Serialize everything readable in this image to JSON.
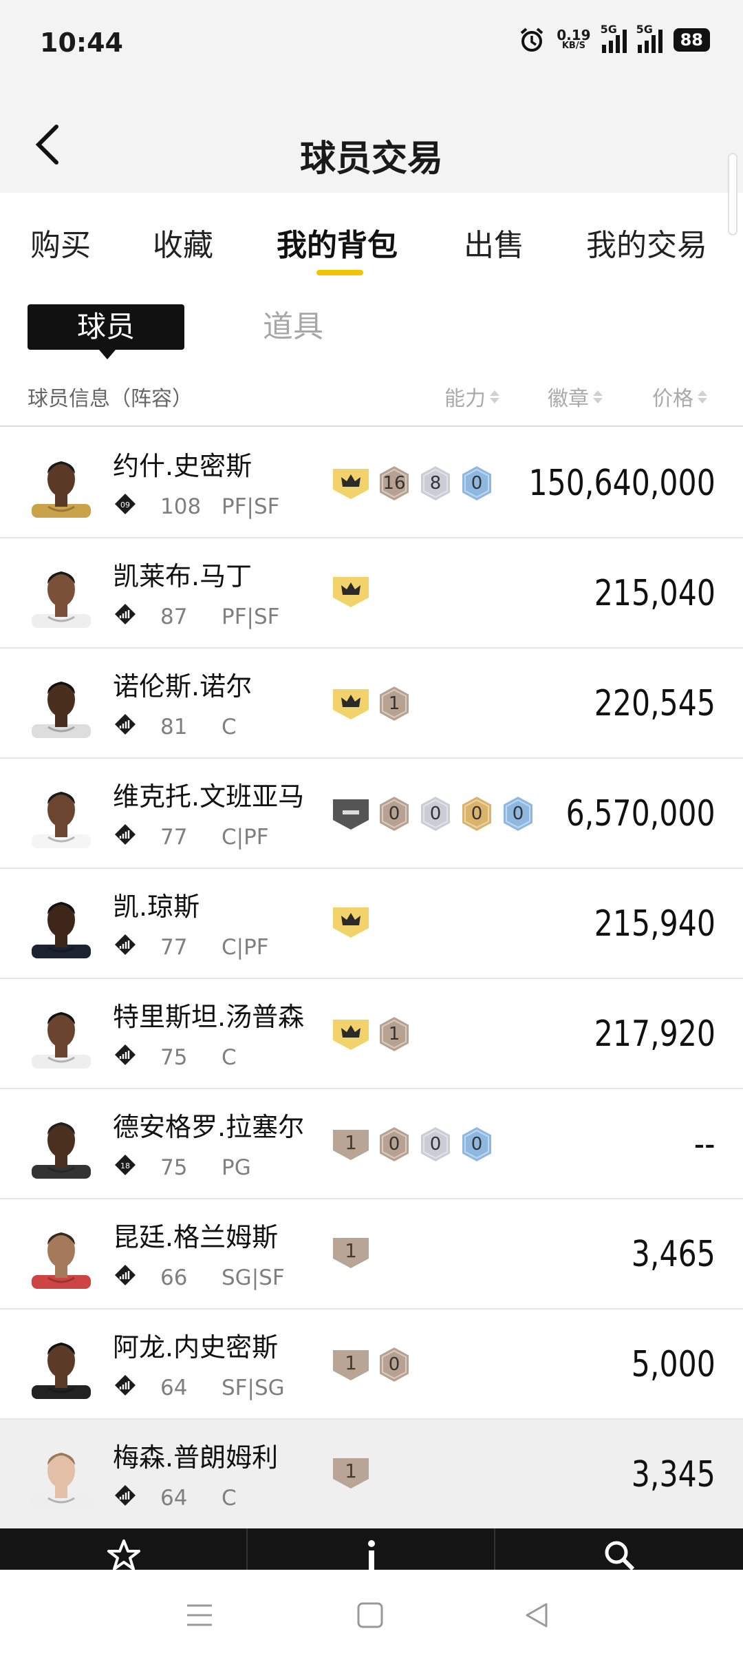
{
  "status_bar": {
    "time": "10:44",
    "net_speed_value": "0.19",
    "net_speed_unit": "KB/S",
    "signal1_label": "5G",
    "signal2_label": "5G",
    "battery": "88"
  },
  "header": {
    "title": "球员交易"
  },
  "tabs": [
    {
      "label": "购买"
    },
    {
      "label": "收藏"
    },
    {
      "label": "我的背包"
    },
    {
      "label": "出售"
    },
    {
      "label": "我的交易"
    }
  ],
  "subtabs": {
    "active": "球员",
    "inactive": "道具"
  },
  "columns": {
    "info": "球员信息（阵容）",
    "ability": "能力",
    "badge": "徽章",
    "price": "价格"
  },
  "colors": {
    "accent": "#f2c300",
    "gold_shield": "#f2d36b",
    "bronze": "#b7a292",
    "silver": "#c8cdd6",
    "gold": "#d9b46a",
    "blue": "#8fb8e0"
  },
  "players": [
    {
      "name": "约什.史密斯",
      "tier": "09",
      "ovr": "108",
      "pos": "PF|SF",
      "price": "150,640,000",
      "badges": [
        {
          "kind": "crown",
          "color": "gold_shield"
        },
        {
          "kind": "hex",
          "text": "16",
          "color": "bronze"
        },
        {
          "kind": "hex",
          "text": "8",
          "color": "silver"
        },
        {
          "kind": "hex",
          "text": "0",
          "color": "blue"
        }
      ]
    },
    {
      "name": "凯莱布.马丁",
      "tier": "",
      "ovr": "87",
      "pos": "PF|SF",
      "price": "215,040",
      "badges": [
        {
          "kind": "crown",
          "color": "gold_shield"
        }
      ]
    },
    {
      "name": "诺伦斯.诺尔",
      "tier": "",
      "ovr": "81",
      "pos": "C",
      "price": "220,545",
      "badges": [
        {
          "kind": "crown",
          "color": "gold_shield"
        },
        {
          "kind": "hex",
          "text": "1",
          "color": "bronze"
        }
      ]
    },
    {
      "name": "维克托.文班亚马",
      "tier": "",
      "ovr": "77",
      "pos": "C|PF",
      "price": "6,570,000",
      "badges": [
        {
          "kind": "dash"
        },
        {
          "kind": "hex",
          "text": "0",
          "color": "bronze"
        },
        {
          "kind": "hex",
          "text": "0",
          "color": "silver"
        },
        {
          "kind": "hex",
          "text": "0",
          "color": "gold"
        },
        {
          "kind": "hex",
          "text": "0",
          "color": "blue"
        }
      ]
    },
    {
      "name": "凯.琼斯",
      "tier": "",
      "ovr": "77",
      "pos": "C|PF",
      "price": "215,940",
      "badges": [
        {
          "kind": "crown",
          "color": "gold_shield"
        }
      ]
    },
    {
      "name": "特里斯坦.汤普森",
      "tier": "",
      "ovr": "75",
      "pos": "C",
      "price": "217,920",
      "badges": [
        {
          "kind": "crown",
          "color": "gold_shield"
        },
        {
          "kind": "hex",
          "text": "1",
          "color": "bronze"
        }
      ]
    },
    {
      "name": "德安格罗.拉塞尔",
      "tier": "18",
      "ovr": "75",
      "pos": "PG",
      "price": "--",
      "badges": [
        {
          "kind": "shield",
          "text": "1"
        },
        {
          "kind": "hex",
          "text": "0",
          "color": "bronze"
        },
        {
          "kind": "hex",
          "text": "0",
          "color": "silver"
        },
        {
          "kind": "hex",
          "text": "0",
          "color": "blue"
        }
      ]
    },
    {
      "name": "昆廷.格兰姆斯",
      "tier": "",
      "ovr": "66",
      "pos": "SG|SF",
      "price": "3,465",
      "badges": [
        {
          "kind": "shield",
          "text": "1"
        }
      ]
    },
    {
      "name": "阿龙.内史密斯",
      "tier": "",
      "ovr": "64",
      "pos": "SF|SG",
      "price": "5,000",
      "badges": [
        {
          "kind": "shield",
          "text": "1"
        },
        {
          "kind": "hex",
          "text": "0",
          "color": "bronze"
        }
      ]
    },
    {
      "name": "梅森.普朗姆利",
      "tier": "",
      "ovr": "64",
      "pos": "C",
      "price": "3,345",
      "badges": [
        {
          "kind": "shield",
          "text": "1"
        }
      ]
    }
  ],
  "bottom_nav": [
    {
      "icon": "star-icon"
    },
    {
      "icon": "info-icon"
    },
    {
      "icon": "search-icon"
    }
  ],
  "system_nav": [
    {
      "icon": "menu-icon"
    },
    {
      "icon": "home-icon"
    },
    {
      "icon": "back-icon"
    }
  ]
}
